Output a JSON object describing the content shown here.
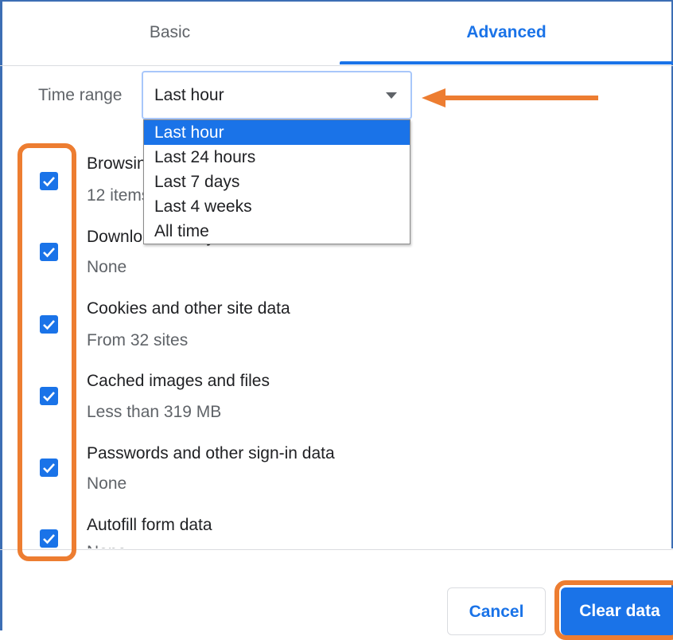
{
  "tabs": [
    {
      "label": "Basic",
      "active": false
    },
    {
      "label": "Advanced",
      "active": true
    }
  ],
  "time_range": {
    "label": "Time range",
    "selected": "Last hour",
    "options": [
      "Last hour",
      "Last 24 hours",
      "Last 7 days",
      "Last 4 weeks",
      "All time"
    ]
  },
  "items": [
    {
      "title": "Browsing history",
      "subtitle": "12 items",
      "checked": true
    },
    {
      "title": "Download history",
      "subtitle": "None",
      "checked": true
    },
    {
      "title": "Cookies and other site data",
      "subtitle": "From 32 sites",
      "checked": true
    },
    {
      "title": "Cached images and files",
      "subtitle": "Less than 319 MB",
      "checked": true
    },
    {
      "title": "Passwords and other sign-in data",
      "subtitle": "None",
      "checked": true
    },
    {
      "title": "Autofill form data",
      "subtitle": "None",
      "checked": true
    }
  ],
  "footer": {
    "cancel_label": "Cancel",
    "clear_label": "Clear data"
  },
  "colors": {
    "accent": "#1a73e8",
    "annotation": "#ed7d31"
  }
}
